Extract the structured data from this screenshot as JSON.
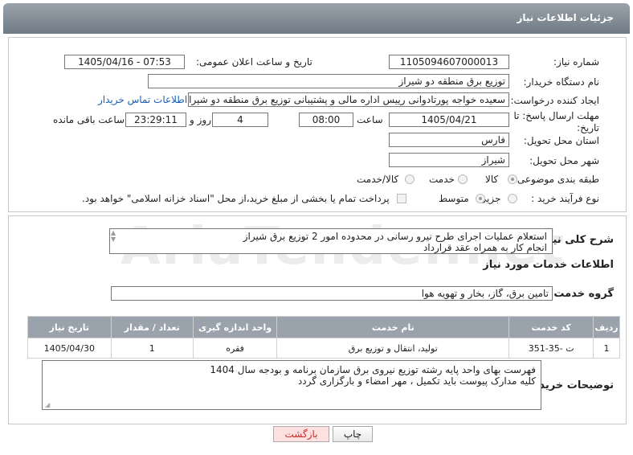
{
  "header": {
    "title": "جزئیات اطلاعات نیاز"
  },
  "watermark": "AriaTender.net",
  "form": {
    "need_number_label": "شماره نیاز:",
    "need_number": "1105094607000013",
    "announce_label": "تاریخ و ساعت اعلان عمومی:",
    "announce_value": "1405/04/16 - 07:53",
    "buyer_org_label": "نام دستگاه خریدار:",
    "buyer_org": "توزیع برق منطقه دو شیراز",
    "creator_label": "ایجاد کننده درخواست:",
    "creator": "سعیده خواجه پورتادوانی رییس اداره مالی و پشتیبانی  توزیع برق منطقه دو شیراز",
    "contact_link": "اطلاعات تماس خریدار",
    "deadline_label": "مهلت ارسال پاسخ: تا تاریخ:",
    "deadline_date": "1405/04/21",
    "time_label": "ساعت",
    "deadline_time": "08:00",
    "days_value": "4",
    "days_label": "روز و",
    "remaining_time": "23:29:11",
    "remaining_label": "ساعت باقی مانده",
    "province_label": "استان محل تحویل:",
    "province": "فارس",
    "city_label": "شهر محل تحویل:",
    "city": "شیراز",
    "category_label": "طبقه بندی موضوعی:",
    "cat_goods": "کالا",
    "cat_service": "خدمت",
    "cat_goods_service": "کالا/خدمت",
    "process_label": "نوع فرآیند خرید :",
    "proc_partial": "جزیی",
    "proc_medium": "متوسط",
    "proc_note": "پرداخت تمام یا بخشی از مبلغ خرید،از محل \"اسناد خزانه اسلامی\" خواهد بود."
  },
  "summary": {
    "label": "شرح کلی نیاز:",
    "line1": "استعلام عملیات اجرای طرح نیرو رسانی در محدوده امور 2 توزیع برق شیراز",
    "line2": "انجام کار به همراه عقد قرارداد"
  },
  "services": {
    "section_title": "اطلاعات خدمات مورد نیاز",
    "group_label": "گروه خدمت:",
    "group_value": "تامین برق، گاز، بخار و تهویه هوا",
    "columns": [
      "ردیف",
      "کد خدمت",
      "نام خدمت",
      "واحد اندازه گیری",
      "تعداد / مقدار",
      "تاریخ نیاز"
    ],
    "rows": [
      [
        "1",
        "ت -35-351",
        "تولید، انتقال و توزیع برق",
        "فقره",
        "1",
        "1405/04/30"
      ]
    ]
  },
  "buyer_notes": {
    "label": "توضیحات خریدار:",
    "line1": "فهرست بهای واحد پایه رشته توزیع نیروی برق سازمان برنامه و بودجه سال 1404",
    "line2": "کلیه مدارک پیوست باید تکمیل ، مهر امضاء  و بارگزاری گردد"
  },
  "buttons": {
    "print": "چاپ",
    "back": "بازگشت"
  }
}
